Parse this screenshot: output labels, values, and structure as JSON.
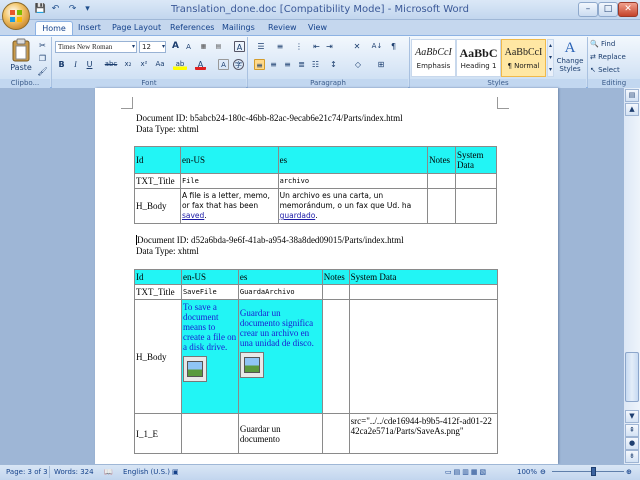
{
  "app": {
    "title": "Translation_done.doc [Compatibility Mode] - Microsoft Word",
    "accent": "#c5d7ee"
  },
  "window_controls": {
    "minimize": "–",
    "maximize": "□",
    "close": "✕"
  },
  "qat": {
    "save": "💾",
    "undo": "↶",
    "redo": "↷",
    "dropdown": "▾"
  },
  "tabs": [
    "Home",
    "Insert",
    "Page Layout",
    "References",
    "Mailings",
    "Review",
    "View"
  ],
  "ribbon": {
    "clipboard": {
      "paste_label": "Paste",
      "group_label": "Clipbo..."
    },
    "font": {
      "font_name": "Times New Roman",
      "font_size": "12",
      "grow": "A",
      "shrink": "A",
      "clear": "A",
      "bold": "B",
      "italic": "I",
      "underline": "U",
      "strike": "abc",
      "subscript": "x₂",
      "superscript": "x²",
      "case": "Aa",
      "highlight": "ab",
      "color": "A",
      "group_label": "Font"
    },
    "paragraph": {
      "group_label": "Paragraph",
      "sort": "A↓",
      "pilcrow": "¶"
    },
    "styles": {
      "items": [
        {
          "sample": "AaBbCcI",
          "name": "Emphasis"
        },
        {
          "sample": "AaBbC",
          "name": "Heading 1"
        },
        {
          "sample": "AaBbCcI",
          "name": "¶ Normal"
        }
      ],
      "change_styles": "Change Styles",
      "group_label": "Styles"
    },
    "editing": {
      "find": "Find",
      "replace": "Replace",
      "select": "Select",
      "group_label": "Editing"
    }
  },
  "document": {
    "block1": {
      "doc_id": "Document ID: b5abcb24-180c-46bb-82ac-9ecab6e21c74/Parts/index.html",
      "data_type": "Data Type: xhtml",
      "headers": [
        "Id",
        "en-US",
        "es",
        "Notes",
        "System Data"
      ],
      "rows": [
        {
          "id": "TXT_Title",
          "en": "File",
          "es": "archivo"
        },
        {
          "id": "H_Body",
          "en_pre": "A file is a letter, memo, or fax that has been ",
          "en_link": "saved",
          "en_post": ".",
          "es_pre": "Un archivo es una carta, un memorándum, o un fax que Ud. ha ",
          "es_link": "guardado",
          "es_post": "."
        }
      ]
    },
    "block2": {
      "doc_id": "Document ID: d52a6bda-9e6f-41ab-a954-38a8ded09015/Parts/index.html",
      "data_type": "Data Type: xhtml",
      "headers": [
        "Id",
        "en-US",
        "es",
        "Notes",
        "System Data"
      ],
      "rows": [
        {
          "id": "TXT_Title",
          "en": "SaveFile",
          "es": "GuardaArchivo"
        },
        {
          "id": "H_Body",
          "en": "To save a document means to create a file on a disk drive.",
          "es": "Guardar un documento significa crear un archivo en una unidad de disco."
        },
        {
          "id": "I_1_E",
          "es": "Guardar un documento",
          "sys": "src=\"../../cde16944-b9b5-412f-ad01-2242ca2e571a/Parts/SaveAs.png\""
        }
      ]
    }
  },
  "status": {
    "page": "Page: 3 of 3",
    "words": "Words: 324",
    "language": "English (U.S.)",
    "zoom": "100%",
    "zoom_level_percent": 100
  }
}
